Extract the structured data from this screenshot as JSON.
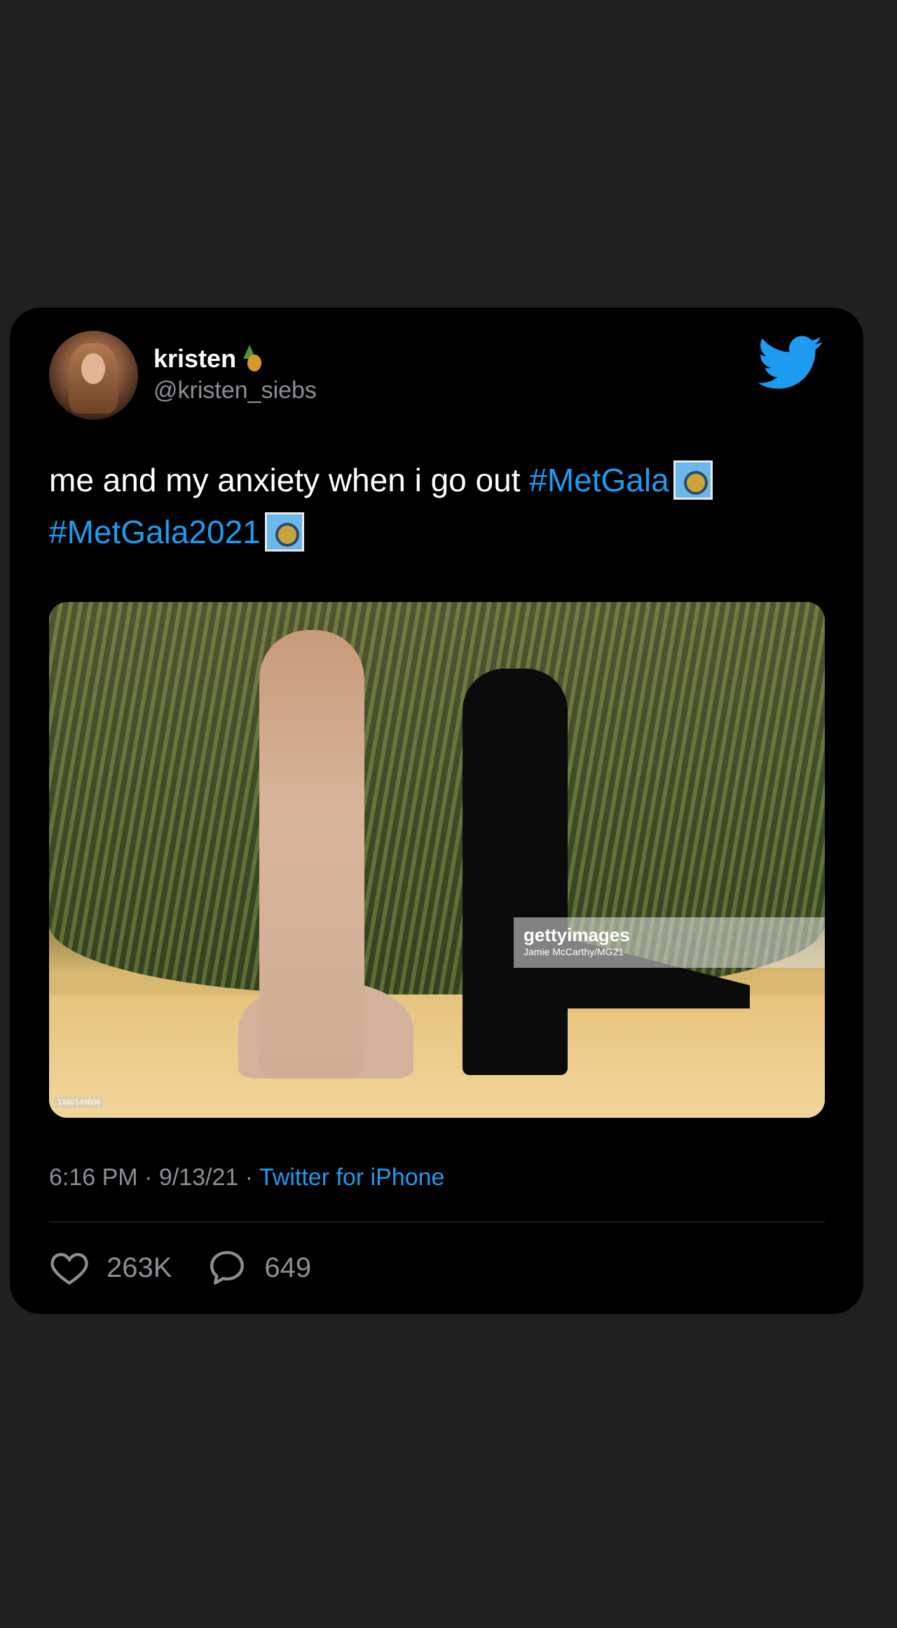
{
  "tweet": {
    "display_name": "kristen",
    "name_emoji": "pineapple-icon",
    "handle": "@kristen_siebs",
    "text_plain": "me and my anxiety when i go out ",
    "hashtag_1": "#MetGala",
    "hashtag_2": "#MetGala2021",
    "hashtag_emoji": "camera-emoji",
    "image_watermark_brand": "gettyimages",
    "image_watermark_credit": "Jamie McCarthy/MG21",
    "image_id": "1340149806",
    "time": "6:16 PM",
    "separator": " · ",
    "date": "9/13/21",
    "source": "Twitter for iPhone",
    "likes": "263K",
    "replies": "649"
  },
  "colors": {
    "background": "#202020",
    "card": "#000000",
    "link": "#1d9bf0",
    "muted": "#8b8f94",
    "twitter_blue": "#1d9bf0"
  }
}
